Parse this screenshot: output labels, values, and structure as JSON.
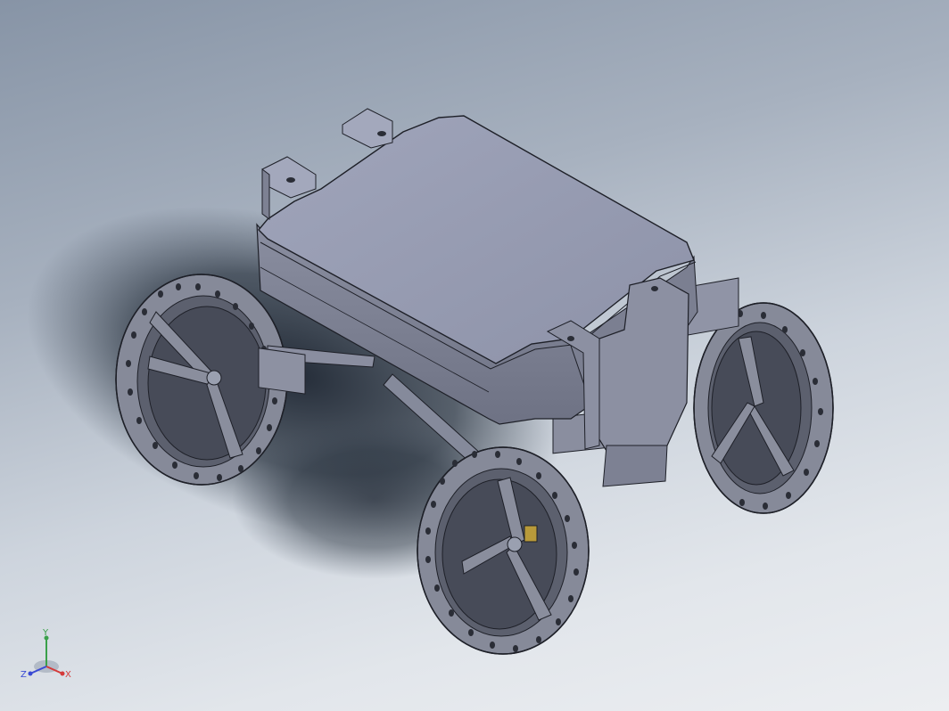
{
  "viewport": {
    "background_top": "#8794a6",
    "background_bottom": "#eceef1"
  },
  "model": {
    "icon": "rover-model-icon",
    "body_color": "#979cb1",
    "wheel_color": "#8f93a2",
    "edge_color": "#1e2028"
  },
  "triad": {
    "icon": "axis-triad-icon",
    "x_label": "X",
    "y_label": "Y",
    "z_label": "Z",
    "x_color": "#d43a3a",
    "y_color": "#3aa04a",
    "z_color": "#3a4ad4"
  }
}
